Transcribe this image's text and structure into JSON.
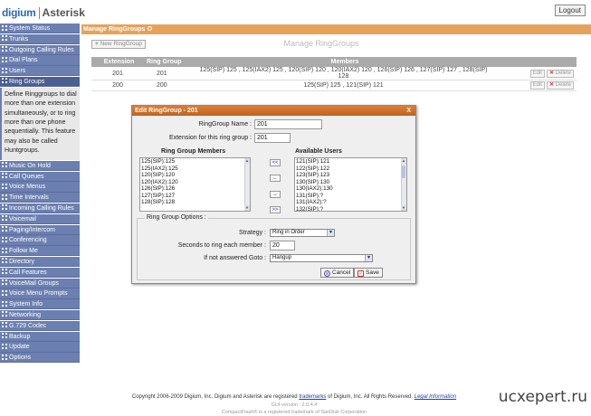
{
  "header": {
    "brand_left": "digium",
    "brand_right": "Asterisk",
    "logout_label": "Logout"
  },
  "sidebar": {
    "items_top": [
      {
        "label": "System Status"
      },
      {
        "label": "Trunks"
      },
      {
        "label": "Outgoing Calling Rules"
      },
      {
        "label": "Dial Plans"
      },
      {
        "label": "Users"
      },
      {
        "label": "Ring Groups"
      }
    ],
    "ring_description": "Define Ringgroups to dial more than one extension simultaneously, or to ring more than one phone sequentially. This feature may also be called Huntgroups.",
    "items_bottom": [
      {
        "label": "Music On Hold"
      },
      {
        "label": "Call Queues"
      },
      {
        "label": "Voice Menus"
      },
      {
        "label": "Time Intervals"
      },
      {
        "label": "Incoming Calling Rules"
      },
      {
        "label": "Voicemail"
      },
      {
        "label": "Paging/Intercom"
      },
      {
        "label": "Conferencing"
      },
      {
        "label": "Follow Me"
      },
      {
        "label": "Directory"
      },
      {
        "label": "Call Features"
      },
      {
        "label": "VoiceMail Groups"
      },
      {
        "label": "Voice Menu Prompts"
      },
      {
        "label": "System Info"
      },
      {
        "label": "Networking"
      },
      {
        "label": "G.729 Codec"
      },
      {
        "label": "Backup"
      },
      {
        "label": "Update"
      },
      {
        "label": "Options"
      }
    ]
  },
  "main": {
    "section_title": "Manage RingGroups",
    "new_button": "New RingGroup",
    "page_title": "Manage RingGroups",
    "columns": [
      "Extension",
      "Ring Group",
      "Members"
    ],
    "rows": [
      {
        "extension": "201",
        "group": "201",
        "members": "125(SIP) 125 , 125(IAX2) 125 , 120(SIP) 120 , 120(IAX2) 120 , 126(SIP) 126 , 127(SIP) 127 , 128(SIP) 128"
      },
      {
        "extension": "200",
        "group": "200",
        "members": "125(SIP) 125 , 121(SIP) 121"
      }
    ],
    "edit_label": "Edit",
    "delete_label": "Delete"
  },
  "dialog": {
    "title": "Edit RingGroup - 201",
    "close": "X",
    "name_label": "RingGroup Name :",
    "name_value": "201",
    "ext_label": "Extension for this ring group :",
    "ext_value": "201",
    "members_header": "Ring Group Members",
    "members": [
      "125(SIP):125",
      "125(IAX2):125",
      "120(SIP):120",
      "120(IAX2):120",
      "126(SIP):126",
      "127(SIP):127",
      "128(SIP):128"
    ],
    "available_header": "Available Users",
    "available": [
      "121(SIP):121",
      "122(SIP):122",
      "123(SIP):123",
      "130(SIP):130",
      "130(IAX2):130",
      "131(SIP):?",
      "131(IAX2):?",
      "132(SIP):?"
    ],
    "move_buttons": [
      "<<",
      "←",
      "→",
      ">>"
    ],
    "options_legend": "Ring Group Options :",
    "strategy_label": "Strategy :",
    "strategy_value": "Ring in Order",
    "seconds_label": "Seconds to ring each member :",
    "seconds_value": "20",
    "goto_label": "If not answered Goto :",
    "goto_value": "Hangup",
    "cancel_label": "Cancel",
    "save_label": "Save"
  },
  "footer": {
    "copyright_pre": "Copyright 2006-2009 Digium, Inc. Digium and Asterisk are registered",
    "trademarks_link": "trademarks",
    "copyright_post": "of Digium, Inc. All Rights Reserved.",
    "legal_link": "Legal Information",
    "gui_version": "GUI-version : 2.0.4.4",
    "compactflash": "CompactFlash® is a registered trademark of SanDisk Corporation"
  },
  "watermark": "ucxepert.ru",
  "colors": {
    "nav": "#6b7fb0",
    "header": "#e6a25a",
    "dialog_title": "#c0621e"
  }
}
